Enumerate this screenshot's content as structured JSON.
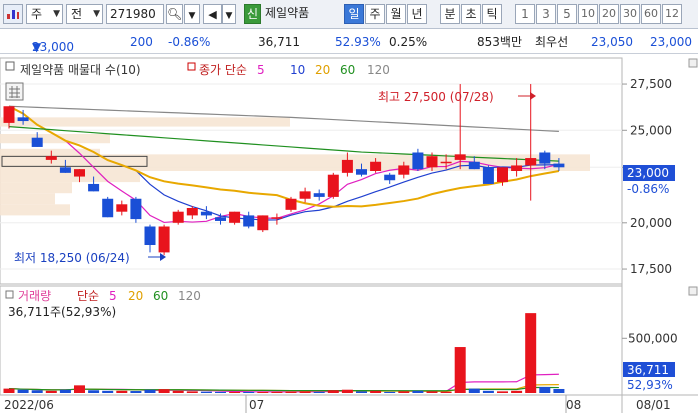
{
  "toolbar": {
    "market": "주",
    "jeon": "전",
    "code": "271980",
    "sin": "신",
    "stock_name": "제일약품",
    "periods": [
      "일",
      "주",
      "월",
      "년",
      "분",
      "초",
      "틱"
    ],
    "minutes": [
      "1",
      "3",
      "5",
      "10",
      "20",
      "30",
      "60",
      "12"
    ]
  },
  "quote": {
    "price": "23,000",
    "change": "200",
    "change_pct": "-0.86%",
    "volume": "36,711",
    "vol_ratio": "52.93%",
    "turnover": "0.25%",
    "amount": "853백만",
    "best_label": "최우선",
    "best_ask": "23,050",
    "best_bid": "23,000"
  },
  "price_panel": {
    "legend_name": "제일약품 매물대 수(10)",
    "legend_ma": "종가 단순",
    "ma_periods": [
      "5",
      "10",
      "20",
      "60",
      "120"
    ],
    "high_label": "최고 27,500 (07/28)",
    "low_label": "최저 18,250 (06/24)",
    "cur_price": "23,000",
    "cur_pct": "-0.86%"
  },
  "volume_panel": {
    "legend_name": "거래량",
    "legend_ma": "단순",
    "ma_periods": [
      "5",
      "20",
      "60",
      "120"
    ],
    "info": "36,711주(52,93%)",
    "cur_volume": "36,711",
    "cur_pct": "52,93%"
  },
  "x_labels": [
    "2022/06",
    "07",
    "08",
    "08/01"
  ],
  "chart_data": {
    "type": "candlestick",
    "price_axis": {
      "ticks": [
        27500,
        25000,
        23000,
        20000,
        17500
      ],
      "labels": [
        "27,500",
        "25,000",
        "23,000",
        "20,000",
        "17,500"
      ],
      "range": [
        16800,
        28800
      ]
    },
    "volume_axis": {
      "ticks": [
        500000
      ],
      "labels": [
        "500,000"
      ],
      "range": [
        0,
        850000
      ]
    },
    "candles": [
      {
        "o": 25400,
        "h": 25900,
        "l": 25100,
        "c": 26300
      },
      {
        "o": 25700,
        "h": 26100,
        "l": 25300,
        "c": 25500
      },
      {
        "o": 24600,
        "h": 24900,
        "l": 24100,
        "c": 24100
      },
      {
        "o": 23400,
        "h": 23900,
        "l": 23200,
        "c": 23600
      },
      {
        "o": 23000,
        "h": 23400,
        "l": 22700,
        "c": 22700
      },
      {
        "o": 22500,
        "h": 22900,
        "l": 22200,
        "c": 22900
      },
      {
        "o": 22100,
        "h": 22500,
        "l": 21700,
        "c": 21700
      },
      {
        "o": 21300,
        "h": 21400,
        "l": 20300,
        "c": 20300
      },
      {
        "o": 20600,
        "h": 21200,
        "l": 20400,
        "c": 21000
      },
      {
        "o": 21300,
        "h": 21400,
        "l": 20000,
        "c": 20200
      },
      {
        "o": 19800,
        "h": 19900,
        "l": 18400,
        "c": 18800
      },
      {
        "o": 18400,
        "h": 19900,
        "l": 18250,
        "c": 19800
      },
      {
        "o": 20000,
        "h": 20700,
        "l": 19900,
        "c": 20600
      },
      {
        "o": 20400,
        "h": 20900,
        "l": 20200,
        "c": 20800
      },
      {
        "o": 20600,
        "h": 20900,
        "l": 20200,
        "c": 20400
      },
      {
        "o": 20300,
        "h": 20500,
        "l": 19900,
        "c": 20100
      },
      {
        "o": 20000,
        "h": 20600,
        "l": 19900,
        "c": 20600
      },
      {
        "o": 20400,
        "h": 20600,
        "l": 19700,
        "c": 19800
      },
      {
        "o": 19600,
        "h": 20400,
        "l": 19500,
        "c": 20400
      },
      {
        "o": 20300,
        "h": 20500,
        "l": 19900,
        "c": 20300
      },
      {
        "o": 20700,
        "h": 21400,
        "l": 20600,
        "c": 21300
      },
      {
        "o": 21300,
        "h": 21900,
        "l": 21100,
        "c": 21700
      },
      {
        "o": 21600,
        "h": 21800,
        "l": 21200,
        "c": 21400
      },
      {
        "o": 21400,
        "h": 22700,
        "l": 21300,
        "c": 22600
      },
      {
        "o": 22700,
        "h": 23800,
        "l": 22500,
        "c": 23400
      },
      {
        "o": 22900,
        "h": 23200,
        "l": 22500,
        "c": 22600
      },
      {
        "o": 22800,
        "h": 23500,
        "l": 22700,
        "c": 23300
      },
      {
        "o": 22600,
        "h": 22700,
        "l": 22100,
        "c": 22300
      },
      {
        "o": 22600,
        "h": 23300,
        "l": 22400,
        "c": 23100
      },
      {
        "o": 23800,
        "h": 24000,
        "l": 22800,
        "c": 22900
      },
      {
        "o": 23000,
        "h": 23800,
        "l": 22800,
        "c": 23600
      },
      {
        "o": 23300,
        "h": 23700,
        "l": 22900,
        "c": 23300
      },
      {
        "o": 23400,
        "h": 27500,
        "l": 22900,
        "c": 23700
      },
      {
        "o": 23300,
        "h": 23600,
        "l": 22900,
        "c": 22900
      },
      {
        "o": 23000,
        "h": 23100,
        "l": 22100,
        "c": 22100
      },
      {
        "o": 22200,
        "h": 23000,
        "l": 22000,
        "c": 23000
      },
      {
        "o": 22800,
        "h": 23500,
        "l": 22500,
        "c": 23100
      },
      {
        "o": 23100,
        "h": 27500,
        "l": 21200,
        "c": 23500
      },
      {
        "o": 23800,
        "h": 23900,
        "l": 22900,
        "c": 23200
      },
      {
        "o": 23200,
        "h": 23500,
        "l": 22800,
        "c": 23000
      }
    ],
    "volumes": [
      40000,
      30000,
      25000,
      20000,
      30000,
      70000,
      25000,
      20000,
      20000,
      18000,
      30000,
      35000,
      20000,
      15000,
      12000,
      10000,
      10000,
      10000,
      10000,
      10000,
      12000,
      15000,
      10000,
      25000,
      30000,
      15000,
      20000,
      10000,
      15000,
      20000,
      15000,
      12000,
      420000,
      40000,
      20000,
      15000,
      20000,
      730000,
      55000,
      36711
    ]
  }
}
